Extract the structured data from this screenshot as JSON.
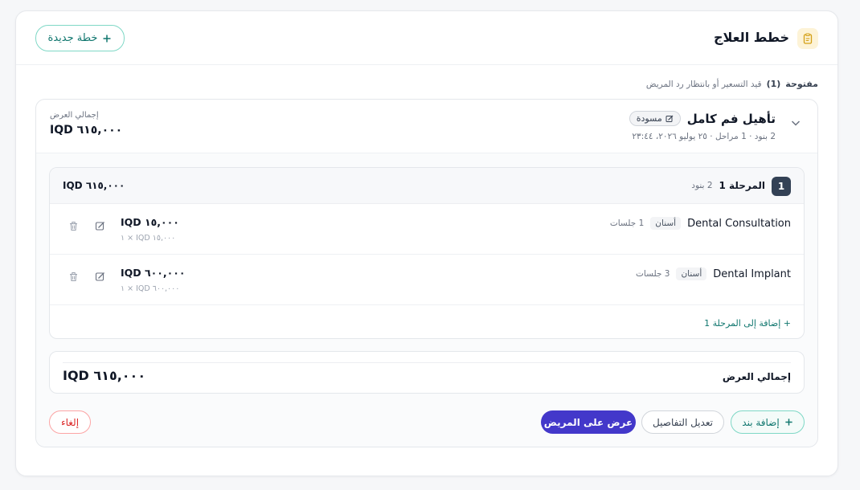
{
  "header": {
    "title": "خطط العلاج",
    "new_plan_label": "خطة جديدة",
    "accent": "#0f766e",
    "icon": "clipboard-icon"
  },
  "status": {
    "open_label": "مفتوحة",
    "open_count": "(1)",
    "hint": "قيد التسعير أو بانتظار رد المريض"
  },
  "plan": {
    "name": "تأهيل فم كامل",
    "badge": "مسودة",
    "meta": "2 بنود · 1 مراحل · ٢٥ يوليو ٢٠٢٦، ٢٣:٤٤",
    "total_label": "إجمالي العرض",
    "total_value": "IQD ٦١٥,٠٠٠",
    "stage": {
      "number": "1",
      "label": "المرحلة 1",
      "items_count": "2 بنود",
      "total": "IQD ٦١٥,٠٠٠",
      "add_label": "+ إضافة إلى المرحلة 1",
      "items": [
        {
          "name": "Dental Consultation",
          "tag": "أسنان",
          "sessions": "1 جلسات",
          "price": "IQD ١٥,٠٠٠",
          "sub": "١ × IQD ١٥,٠٠٠"
        },
        {
          "name": "Dental Implant",
          "tag": "أسنان",
          "sessions": "3 جلسات",
          "price": "IQD ٦٠٠,٠٠٠",
          "sub": "١ × IQD ٦٠٠,٠٠٠"
        }
      ]
    },
    "summary_label": "إجمالي العرض",
    "summary_value": "IQD ٦١٥,٠٠٠"
  },
  "actions": {
    "add_item": "إضافة بند",
    "edit_details": "تعديل التفاصيل",
    "present": "عرض على المريض",
    "cancel": "إلغاء"
  },
  "colors": {
    "primary": "#4338ca",
    "danger": "#dc2626",
    "teal": "#0f766e"
  }
}
